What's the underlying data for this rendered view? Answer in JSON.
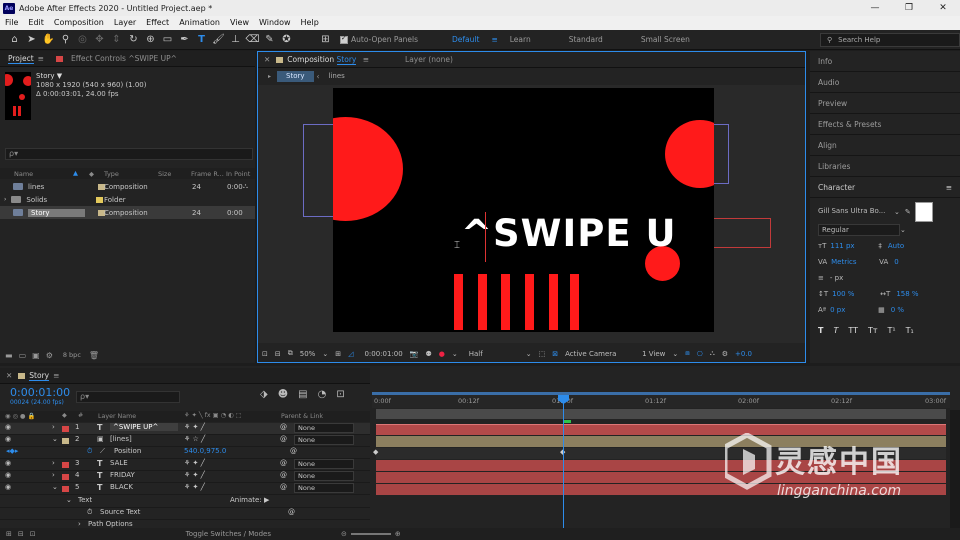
{
  "window": {
    "title": "Adobe After Effects 2020 - Untitled Project.aep *",
    "logo": "Ae",
    "controls": [
      "—",
      "❐",
      "✕"
    ]
  },
  "menu": [
    "File",
    "Edit",
    "Composition",
    "Layer",
    "Effect",
    "Animation",
    "View",
    "Window",
    "Help"
  ],
  "toolbar": {
    "auto_open_label": "Auto-Open Panels",
    "workspaces": [
      "Default",
      "Learn",
      "Standard",
      "Small Screen"
    ],
    "search_placeholder": "Search Help"
  },
  "project": {
    "tab": "Project",
    "effect_tab": "Effect Controls ^SWIPE UP^",
    "comp_name": "Story ▼",
    "comp_size": "1080 x 1920  (540 x 960) (1.00)",
    "comp_duration": "Δ 0:00:03:01, 24.00 fps",
    "search_placeholder": "ρ▾",
    "columns": [
      "Name",
      "Type",
      "Size",
      "Frame R...",
      "In Point"
    ],
    "items": [
      {
        "name": "lines",
        "type": "Composition",
        "frame_rate": "24",
        "in_point": "0:00",
        "label_color": "#c8b88a"
      },
      {
        "name": "Solids",
        "type": "Folder",
        "frame_rate": "",
        "in_point": "",
        "label_color": "#e3c95c"
      },
      {
        "name": "Story",
        "type": "Composition",
        "frame_rate": "24",
        "in_point": "0:00",
        "label_color": "#c8b88a"
      }
    ],
    "footer_bpc": "8 bpc"
  },
  "composition": {
    "tab_prefix": "Composition",
    "tab_name": "Story",
    "layer_tab": "Layer (none)",
    "breadcrumbs": [
      "Story",
      "lines"
    ],
    "canvas_text": "^SWIPE U",
    "footer": {
      "zoom": "50%",
      "timecode": "0:00:01:00",
      "resolution": "Half",
      "camera": "Active Camera",
      "view": "1 View",
      "exposure": "+0.0"
    }
  },
  "right_panels": {
    "sections": [
      "Info",
      "Audio",
      "Preview",
      "Effects & Presets",
      "Align",
      "Libraries"
    ],
    "character": {
      "title": "Character",
      "font_family": "Gill Sans Ultra Bo...",
      "font_style": "Regular",
      "font_size": "111 px",
      "leading": "Auto",
      "kerning": "Metrics",
      "tracking": "0",
      "stroke_width": "- px",
      "vscale": "100 %",
      "hscale": "158 %",
      "baseline": "0 px",
      "tsume": "0 %",
      "styles": [
        "T",
        "T",
        "TT",
        "Tт",
        "T¹",
        "T₁"
      ]
    }
  },
  "timeline": {
    "tab": "Story",
    "timecode": "0:00:01:00",
    "frames": "00024 (24.00 fps)",
    "search_placeholder": "ρ▾",
    "col_layer_name": "Layer Name",
    "col_parent": "Parent & Link",
    "ruler_labels": [
      "0:00f",
      "00:12f",
      "01:00f",
      "01:12f",
      "02:00f",
      "02:12f",
      "03:00f"
    ],
    "layers": [
      {
        "num": "1",
        "type": "T",
        "name": "^SWIPE UP^",
        "parent": "None",
        "label": "#d64646",
        "selected": true
      },
      {
        "num": "2",
        "type": "▣",
        "name": "[lines]",
        "parent": "None",
        "label": "#c8b88a",
        "selected": false
      }
    ],
    "position_label": "Position",
    "position_value": "540.0,975.0",
    "layers2": [
      {
        "num": "3",
        "type": "T",
        "name": "SALE",
        "parent": "None",
        "label": "#d64646"
      },
      {
        "num": "4",
        "type": "T",
        "name": "FRIDAY",
        "parent": "None",
        "label": "#d64646"
      },
      {
        "num": "5",
        "type": "T",
        "name": "BLACK",
        "parent": "None",
        "label": "#d64646"
      }
    ],
    "text_group": "Text",
    "animate_label": "Animate:",
    "source_text": "Source Text",
    "path_options": "Path Options",
    "footer": "Toggle Switches / Modes"
  },
  "watermark": {
    "cn": "灵感中国",
    "en": "lingganchina.com"
  },
  "colors": {
    "accent": "#2d8ceb",
    "red": "#ff1a1a"
  }
}
